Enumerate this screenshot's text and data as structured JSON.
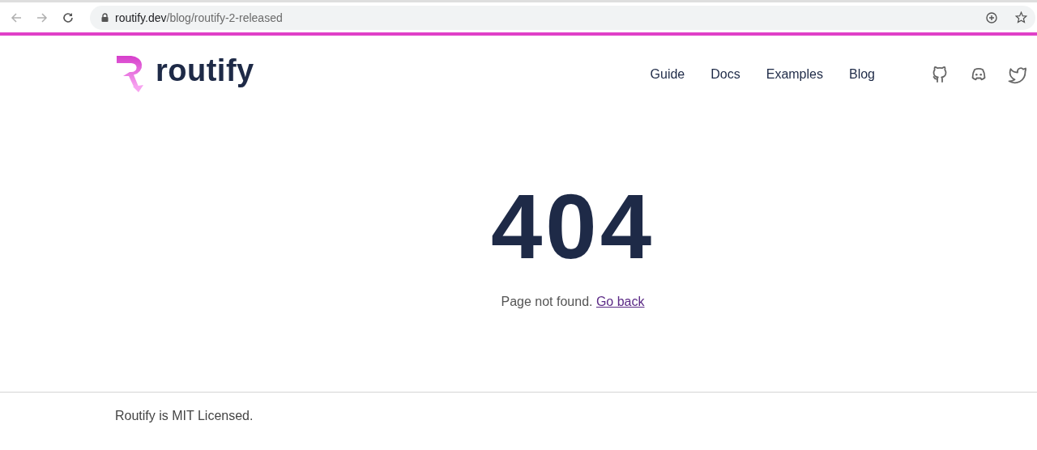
{
  "browser": {
    "url_host": "routify.dev",
    "url_path": "/blog/routify-2-released"
  },
  "header": {
    "logo_text": "routify",
    "nav": [
      {
        "label": "Guide"
      },
      {
        "label": "Docs"
      },
      {
        "label": "Examples"
      },
      {
        "label": "Blog"
      }
    ]
  },
  "error": {
    "code": "404",
    "message": "Page not found.",
    "link": "Go back"
  },
  "footer": {
    "text": "Routify is MIT Licensed."
  }
}
